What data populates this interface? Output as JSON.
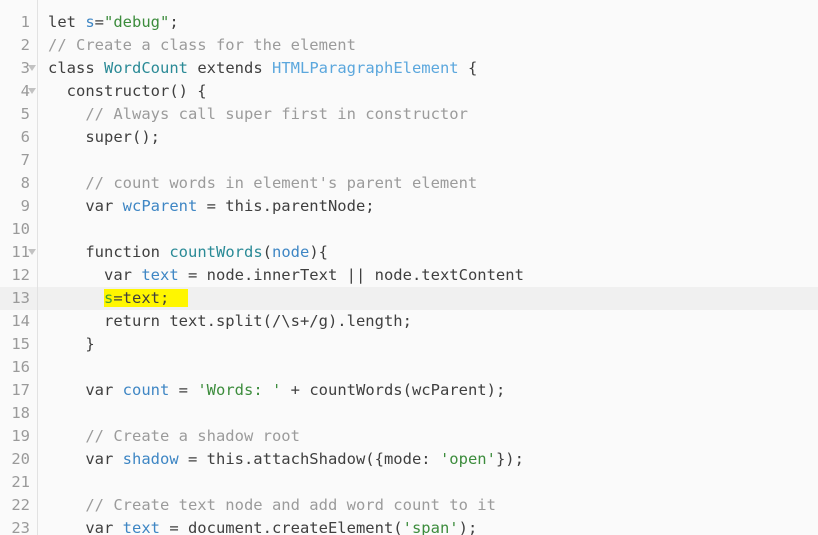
{
  "editor": {
    "name": "code-editor",
    "language": "javascript",
    "font_size_px": 15.5,
    "line_height_px": 23,
    "colors": {
      "background": "#fafafa",
      "gutter_text": "#9a9a9a",
      "gutter_rule": "#e2e2e2",
      "active_line_background": "#f0f0f0",
      "search_highlight": "#fff600",
      "default_text": "#3f3f3f",
      "comment": "#9b9b9b",
      "string": "#3c8c3c",
      "variable": "#3e86c4",
      "class_name": "#2a8a96",
      "function_name": "#2a8a96",
      "builtin_type": "#5ba7dd",
      "fold_arrow": "#c2c2c2"
    },
    "active_line": 13,
    "highlighted_text": "s=text;"
  },
  "lines": [
    {
      "number": "1",
      "fold": false,
      "active": false,
      "tokens": [
        {
          "text": "let ",
          "cls": "t-kw"
        },
        {
          "text": "s",
          "cls": "t-var"
        },
        {
          "text": "=",
          "cls": "t-def"
        },
        {
          "text": "\"debug\"",
          "cls": "t-str"
        },
        {
          "text": ";",
          "cls": "t-def"
        }
      ]
    },
    {
      "number": "2",
      "fold": false,
      "active": false,
      "tokens": [
        {
          "text": "// Create a class for the element",
          "cls": "t-com"
        }
      ]
    },
    {
      "number": "3",
      "fold": true,
      "active": false,
      "tokens": [
        {
          "text": "class ",
          "cls": "t-kw"
        },
        {
          "text": "WordCount",
          "cls": "t-cls"
        },
        {
          "text": " extends ",
          "cls": "t-kw"
        },
        {
          "text": "HTMLParagraphElement",
          "cls": "t-type"
        },
        {
          "text": " {",
          "cls": "t-def"
        }
      ]
    },
    {
      "number": "4",
      "fold": true,
      "active": false,
      "tokens": [
        {
          "text": "  constructor() {",
          "cls": "t-def"
        }
      ]
    },
    {
      "number": "5",
      "fold": false,
      "active": false,
      "tokens": [
        {
          "text": "    // Always call super first in constructor",
          "cls": "t-com"
        }
      ]
    },
    {
      "number": "6",
      "fold": false,
      "active": false,
      "tokens": [
        {
          "text": "    super();",
          "cls": "t-def"
        }
      ]
    },
    {
      "number": "7",
      "fold": false,
      "active": false,
      "tokens": []
    },
    {
      "number": "8",
      "fold": false,
      "active": false,
      "tokens": [
        {
          "text": "    // count words in element's parent element",
          "cls": "t-com"
        }
      ]
    },
    {
      "number": "9",
      "fold": false,
      "active": false,
      "tokens": [
        {
          "text": "    var ",
          "cls": "t-kw"
        },
        {
          "text": "wcParent",
          "cls": "t-var"
        },
        {
          "text": " = this.parentNode;",
          "cls": "t-def"
        }
      ]
    },
    {
      "number": "10",
      "fold": false,
      "active": false,
      "tokens": []
    },
    {
      "number": "11",
      "fold": true,
      "active": false,
      "tokens": [
        {
          "text": "    function ",
          "cls": "t-kw"
        },
        {
          "text": "countWords",
          "cls": "t-fn"
        },
        {
          "text": "(",
          "cls": "t-def"
        },
        {
          "text": "node",
          "cls": "t-var"
        },
        {
          "text": "){",
          "cls": "t-def"
        }
      ]
    },
    {
      "number": "12",
      "fold": false,
      "active": false,
      "tokens": [
        {
          "text": "      var ",
          "cls": "t-kw"
        },
        {
          "text": "text",
          "cls": "t-var"
        },
        {
          "text": " = node.innerText || node.textContent",
          "cls": "t-def"
        }
      ]
    },
    {
      "number": "13",
      "fold": false,
      "active": true,
      "tokens": [
        {
          "text": "      ",
          "cls": "t-def"
        },
        {
          "text": "s",
          "cls": "t-hl-s",
          "hl": true
        },
        {
          "text": "=text;",
          "cls": "t-def",
          "hl": true
        },
        {
          "text": "  ",
          "cls": "t-def",
          "hl": true
        }
      ]
    },
    {
      "number": "14",
      "fold": false,
      "active": false,
      "tokens": [
        {
          "text": "      return text.split(/\\s+/g).length;",
          "cls": "t-def"
        }
      ]
    },
    {
      "number": "15",
      "fold": false,
      "active": false,
      "tokens": [
        {
          "text": "    }",
          "cls": "t-def"
        }
      ]
    },
    {
      "number": "16",
      "fold": false,
      "active": false,
      "tokens": []
    },
    {
      "number": "17",
      "fold": false,
      "active": false,
      "tokens": [
        {
          "text": "    var ",
          "cls": "t-kw"
        },
        {
          "text": "count",
          "cls": "t-var"
        },
        {
          "text": " = ",
          "cls": "t-def"
        },
        {
          "text": "'Words: '",
          "cls": "t-str"
        },
        {
          "text": " + countWords(wcParent);",
          "cls": "t-def"
        }
      ]
    },
    {
      "number": "18",
      "fold": false,
      "active": false,
      "tokens": []
    },
    {
      "number": "19",
      "fold": false,
      "active": false,
      "tokens": [
        {
          "text": "    // Create a shadow root",
          "cls": "t-com"
        }
      ]
    },
    {
      "number": "20",
      "fold": false,
      "active": false,
      "tokens": [
        {
          "text": "    var ",
          "cls": "t-kw"
        },
        {
          "text": "shadow",
          "cls": "t-var"
        },
        {
          "text": " = this.attachShadow({mode: ",
          "cls": "t-def"
        },
        {
          "text": "'open'",
          "cls": "t-str"
        },
        {
          "text": "});",
          "cls": "t-def"
        }
      ]
    },
    {
      "number": "21",
      "fold": false,
      "active": false,
      "tokens": []
    },
    {
      "number": "22",
      "fold": false,
      "active": false,
      "tokens": [
        {
          "text": "    // Create text node and add word count to it",
          "cls": "t-com"
        }
      ]
    },
    {
      "number": "23",
      "fold": false,
      "active": false,
      "tokens": [
        {
          "text": "    var ",
          "cls": "t-kw"
        },
        {
          "text": "text",
          "cls": "t-var"
        },
        {
          "text": " = document.createElement(",
          "cls": "t-def"
        },
        {
          "text": "'span'",
          "cls": "t-str"
        },
        {
          "text": ");",
          "cls": "t-def"
        }
      ]
    }
  ]
}
